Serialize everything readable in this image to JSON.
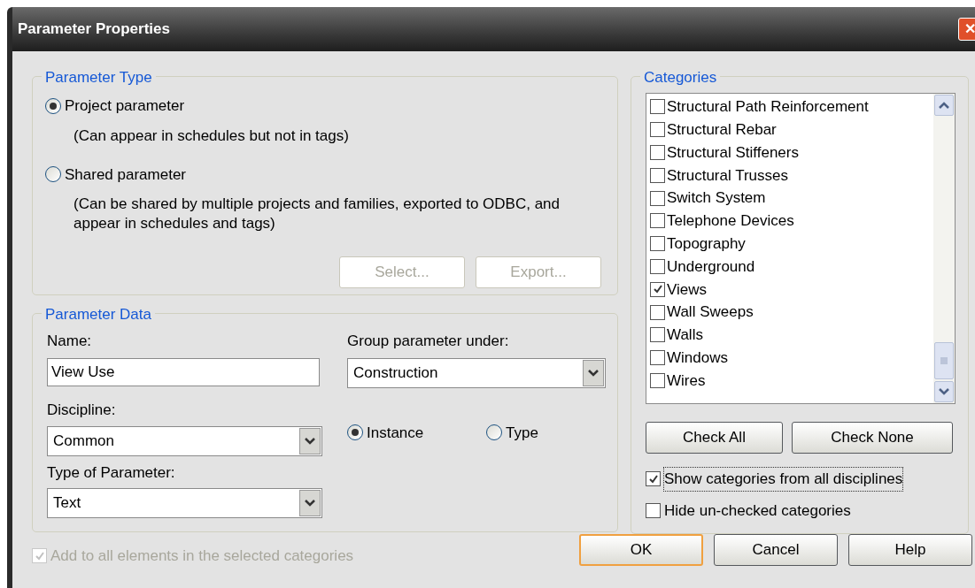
{
  "window": {
    "title": "Parameter Properties",
    "close": "✕"
  },
  "parameter_type": {
    "legend": "Parameter Type",
    "options": [
      {
        "label": "Project parameter",
        "description": "(Can appear in schedules but not in tags)",
        "selected": true
      },
      {
        "label": "Shared parameter",
        "description": "(Can be shared by multiple projects and families, exported to ODBC, and appear in schedules and tags)",
        "selected": false
      }
    ],
    "buttons": [
      {
        "label": "Select...",
        "disabled": true
      },
      {
        "label": "Export...",
        "disabled": true
      }
    ]
  },
  "parameter_data": {
    "legend": "Parameter Data",
    "name": {
      "label": "Name:",
      "value": "View Use"
    },
    "discipline": {
      "label": "Discipline:",
      "value": "Common"
    },
    "type_of_parameter": {
      "label": "Type of Parameter:",
      "value": "Text"
    },
    "group_under": {
      "label": "Group parameter under:",
      "value": "Construction"
    },
    "scope": [
      {
        "label": "Instance",
        "selected": true
      },
      {
        "label": "Type",
        "selected": false
      }
    ]
  },
  "add_to_all": {
    "label": "Add to all elements in the selected categories",
    "checked": true,
    "disabled": true
  },
  "categories": {
    "legend": "Categories",
    "items": [
      {
        "label": "Structural Path Reinforcement",
        "checked": false
      },
      {
        "label": "Structural Rebar",
        "checked": false
      },
      {
        "label": "Structural Stiffeners",
        "checked": false
      },
      {
        "label": "Structural Trusses",
        "checked": false
      },
      {
        "label": "Switch System",
        "checked": false
      },
      {
        "label": "Telephone Devices",
        "checked": false
      },
      {
        "label": "Topography",
        "checked": false
      },
      {
        "label": "Underground",
        "checked": false
      },
      {
        "label": "Views",
        "checked": true
      },
      {
        "label": "Wall Sweeps",
        "checked": false
      },
      {
        "label": "Walls",
        "checked": false
      },
      {
        "label": "Windows",
        "checked": false
      },
      {
        "label": "Wires",
        "checked": false
      }
    ],
    "buttons": [
      "Check All",
      "Check None"
    ],
    "options": [
      {
        "label": "Show categories from all disciplines",
        "checked": true,
        "focused": true
      },
      {
        "label": "Hide un-checked categories",
        "checked": false,
        "focused": false
      }
    ]
  },
  "buttons": [
    {
      "label": "OK",
      "default": true
    },
    {
      "label": "Cancel",
      "default": false
    },
    {
      "label": "Help",
      "default": false
    }
  ]
}
